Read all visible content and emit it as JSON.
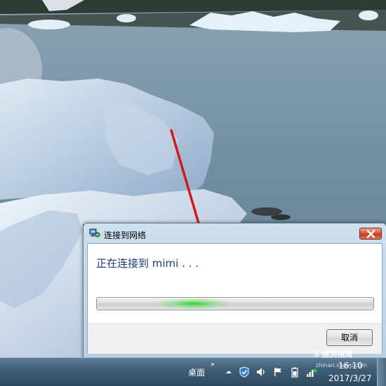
{
  "dialog": {
    "title": "连接到网络",
    "status": "正在连接到 mimi . . .",
    "cancel_label": "取消",
    "title_icon": "network-connect-icon",
    "close_icon": "close-icon"
  },
  "taskbar": {
    "desktop_label": "桌面",
    "overflow_label": "»",
    "time": "16:10",
    "date": "2017/3/27",
    "tray_icons": [
      "show-hidden-icons-icon",
      "security-shield-icon",
      "volume-icon",
      "action-center-flag-icon",
      "battery-icon",
      "network-connecting-icon"
    ]
  },
  "watermark": {
    "text": "S 搜狗指南",
    "sub": "zhinan.sogou.com"
  },
  "colors": {
    "status_text": "#1e3a8a",
    "arrow": "#d21a1a",
    "progress_glow": "#28d728"
  }
}
